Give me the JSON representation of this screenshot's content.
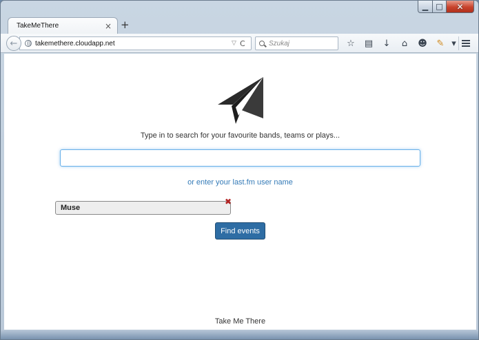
{
  "window": {
    "controls": {
      "minimize": "▁",
      "maximize": "□",
      "close": "✕"
    }
  },
  "tab": {
    "title": "TakeMeThere",
    "close": "×",
    "new_tab": "+"
  },
  "navbar": {
    "back": "←",
    "url": "takemethere.cloudapp.net",
    "url_dropdown": "▽",
    "reload": "C",
    "search_placeholder": "Szukaj",
    "tools": {
      "bookmark_star": "☆",
      "reading_list": "▤",
      "download": "↓",
      "home": "⌂",
      "chat": "☻",
      "addon": "✎",
      "more": "▾"
    }
  },
  "content": {
    "tagline": "Type in to search for your favourite bands, teams or plays...",
    "search_value": "",
    "lastfm_link": "or enter your last.fm user name",
    "selected_tag": "Muse",
    "tag_remove": "✖",
    "find_button": "Find events",
    "footer": "Take Me There"
  },
  "colors": {
    "link": "#337ab7",
    "primary_button": "#2e6da4",
    "focus_ring": "#66afe9",
    "remove_x": "#b22222"
  }
}
